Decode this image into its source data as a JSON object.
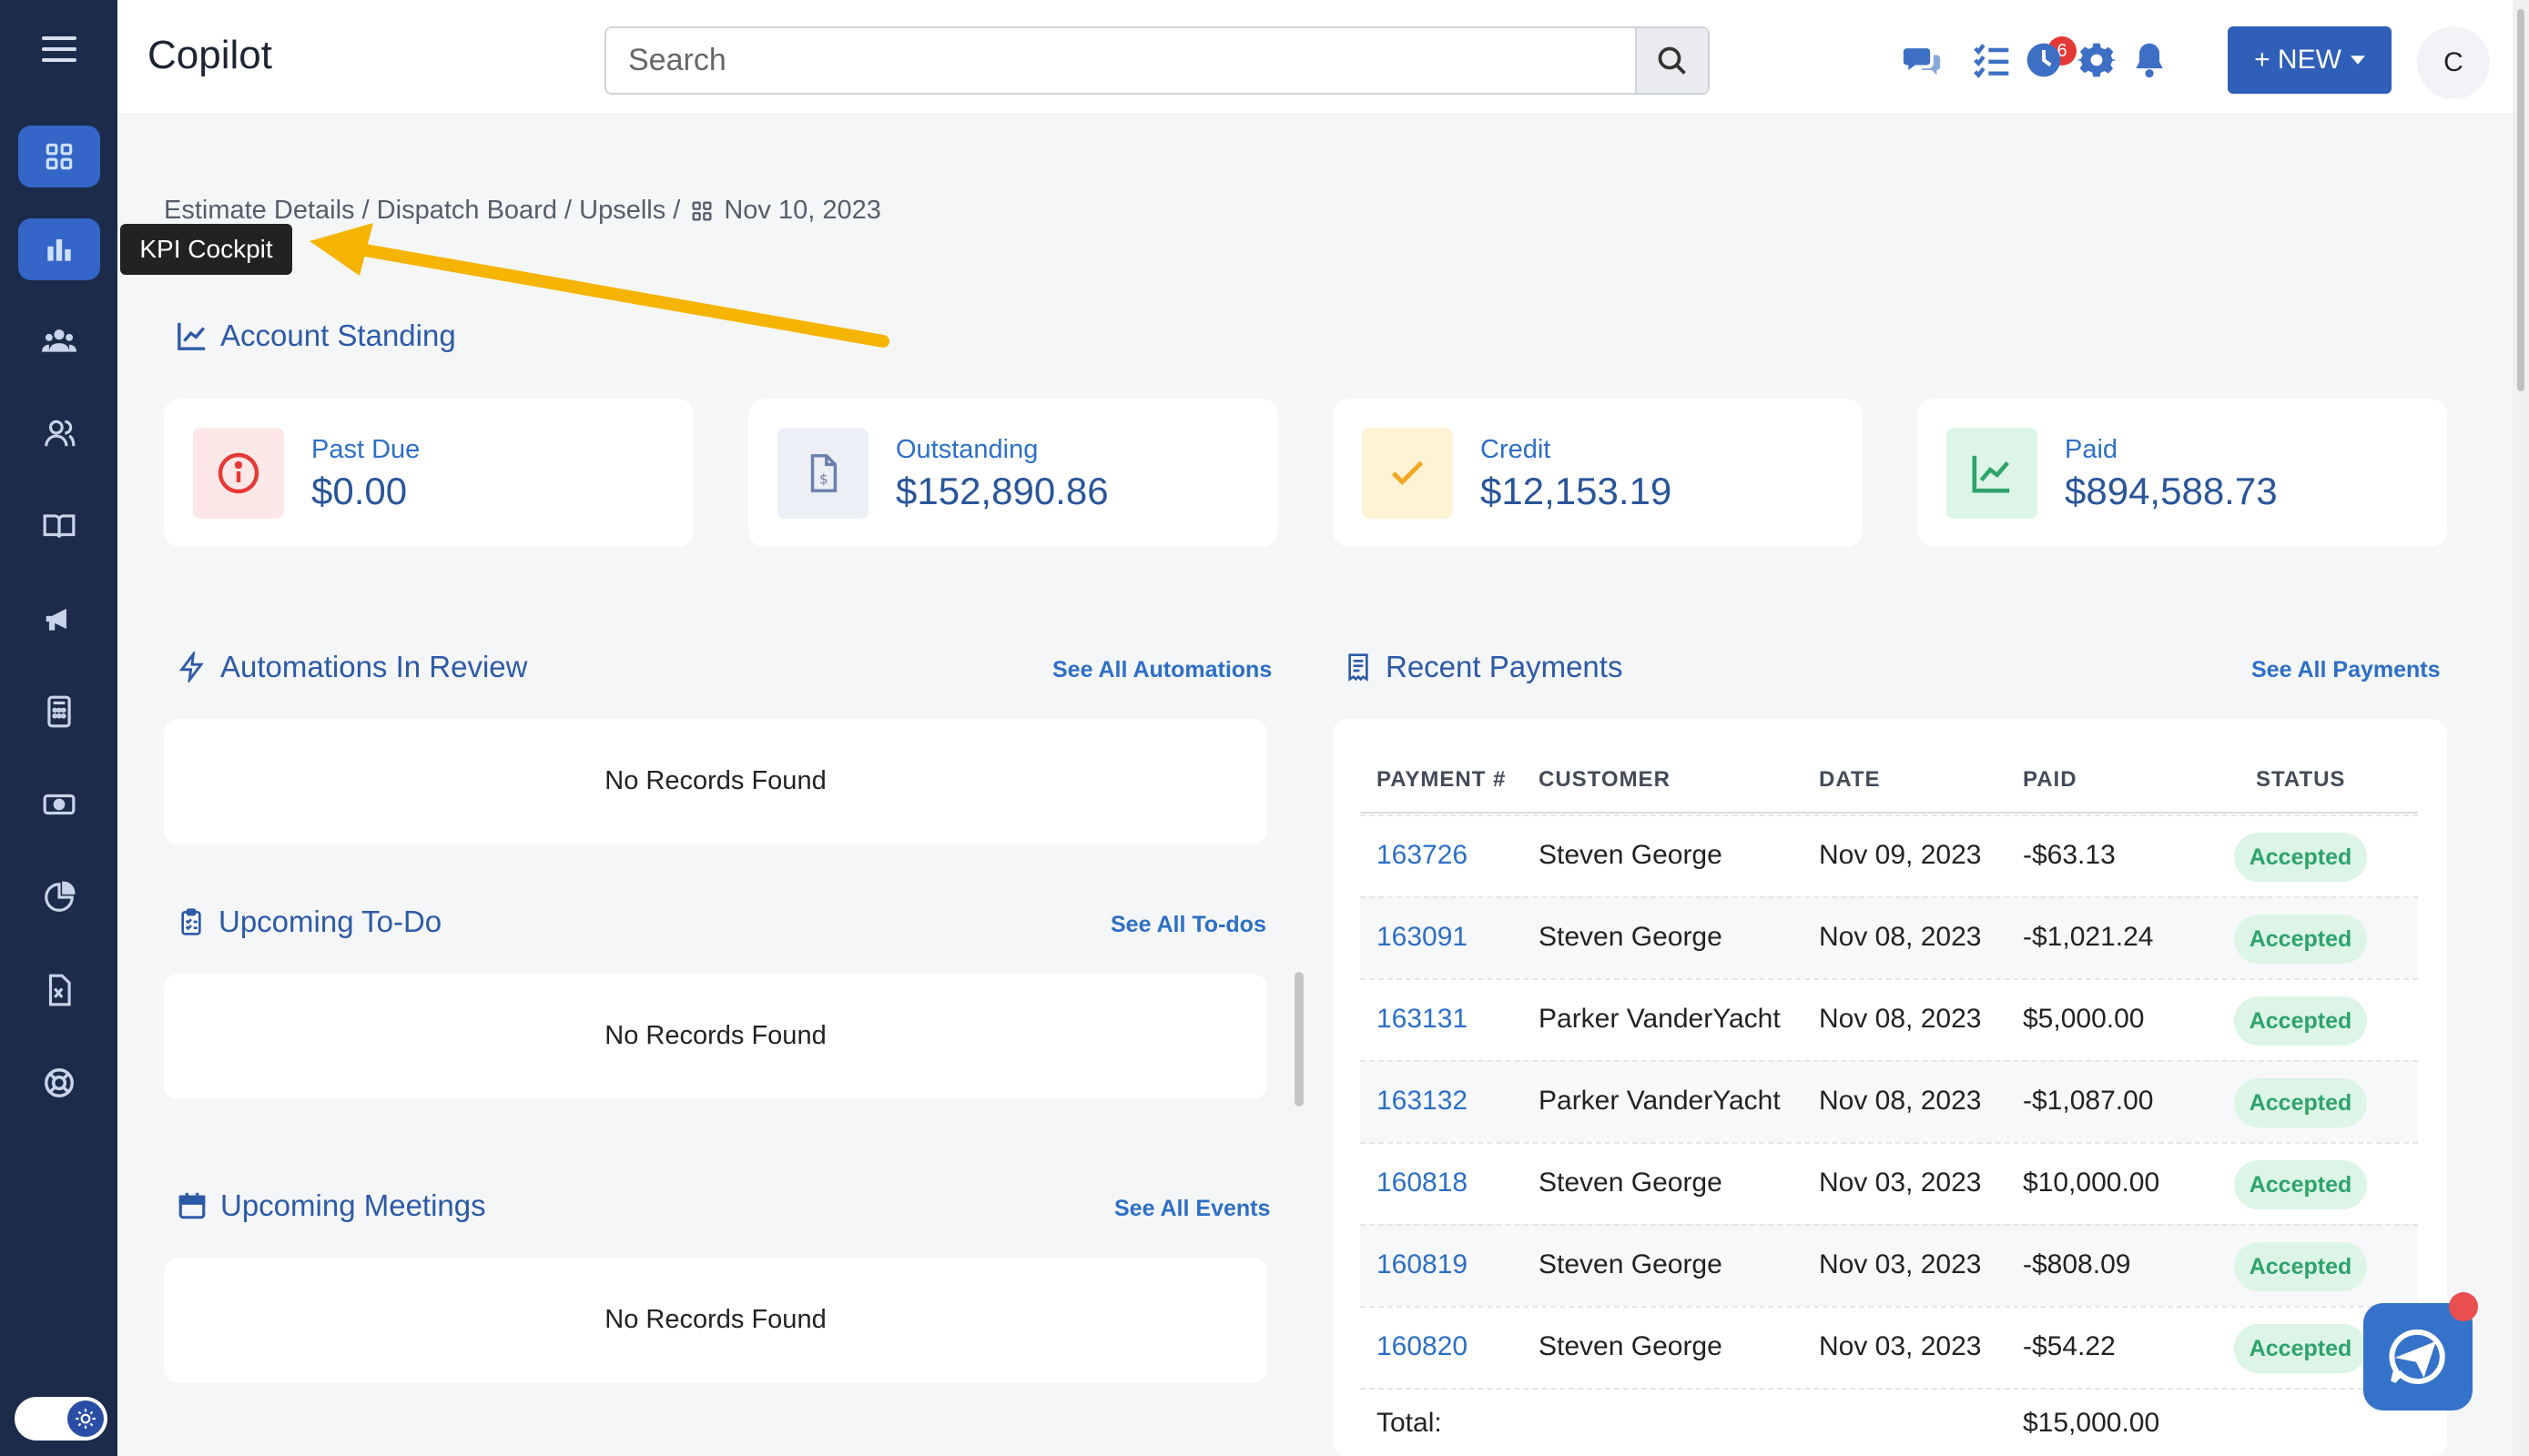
{
  "header": {
    "app_title": "Copilot",
    "search_placeholder": "Search",
    "notification_count": "6",
    "new_button": "+ NEW",
    "avatar_initial": "C"
  },
  "sidebar": {
    "tooltip": "KPI Cockpit",
    "items": [
      {
        "icon": "grid-icon"
      },
      {
        "icon": "bar-chart-icon"
      },
      {
        "icon": "team-icon"
      },
      {
        "icon": "contacts-icon"
      },
      {
        "icon": "book-icon"
      },
      {
        "icon": "megaphone-icon"
      },
      {
        "icon": "calculator-icon"
      },
      {
        "icon": "cash-icon"
      },
      {
        "icon": "pie-chart-icon"
      },
      {
        "icon": "excel-file-icon"
      },
      {
        "icon": "support-icon"
      }
    ]
  },
  "breadcrumb": {
    "path": "Estimate Details / Dispatch Board / Upsells /",
    "date": "Nov 10, 2023"
  },
  "account_standing": {
    "title": "Account Standing",
    "cards": [
      {
        "label": "Past Due",
        "value": "$0.00",
        "color": "#e53935"
      },
      {
        "label": "Outstanding",
        "value": "$152,890.86",
        "color": "#6b7fae"
      },
      {
        "label": "Credit",
        "value": "$12,153.19",
        "color": "#f5a623"
      },
      {
        "label": "Paid",
        "value": "$894,588.73",
        "color": "#2ea36a"
      }
    ]
  },
  "automations": {
    "title": "Automations In Review",
    "link": "See All Automations",
    "empty": "No Records Found"
  },
  "todos": {
    "title": "Upcoming To-Do",
    "link": "See All To-dos",
    "empty": "No Records Found"
  },
  "meetings": {
    "title": "Upcoming Meetings",
    "link": "See All Events",
    "empty": "No Records Found"
  },
  "payments": {
    "title": "Recent Payments",
    "link": "See All Payments",
    "columns": [
      "PAYMENT #",
      "CUSTOMER",
      "DATE",
      "PAID",
      "STATUS"
    ],
    "rows": [
      {
        "id": "163726",
        "customer": "Steven George",
        "date": "Nov 09, 2023",
        "paid": "-$63.13",
        "status": "Accepted"
      },
      {
        "id": "163091",
        "customer": "Steven George",
        "date": "Nov 08, 2023",
        "paid": "-$1,021.24",
        "status": "Accepted"
      },
      {
        "id": "163131",
        "customer": "Parker VanderYacht",
        "date": "Nov 08, 2023",
        "paid": "$5,000.00",
        "status": "Accepted"
      },
      {
        "id": "163132",
        "customer": "Parker VanderYacht",
        "date": "Nov 08, 2023",
        "paid": "-$1,087.00",
        "status": "Accepted"
      },
      {
        "id": "160818",
        "customer": "Steven George",
        "date": "Nov 03, 2023",
        "paid": "$10,000.00",
        "status": "Accepted"
      },
      {
        "id": "160819",
        "customer": "Steven George",
        "date": "Nov 03, 2023",
        "paid": "-$808.09",
        "status": "Accepted"
      },
      {
        "id": "160820",
        "customer": "Steven George",
        "date": "Nov 03, 2023",
        "paid": "-$54.22",
        "status": "Accepted"
      }
    ],
    "total_label": "Total:",
    "total_value": "$15,000.00"
  },
  "colors": {
    "sidebar_bg": "#1c2b4a",
    "accent": "#2f5fb8",
    "status_accepted": "#2ea36a",
    "annotation_arrow": "#f5b400"
  }
}
